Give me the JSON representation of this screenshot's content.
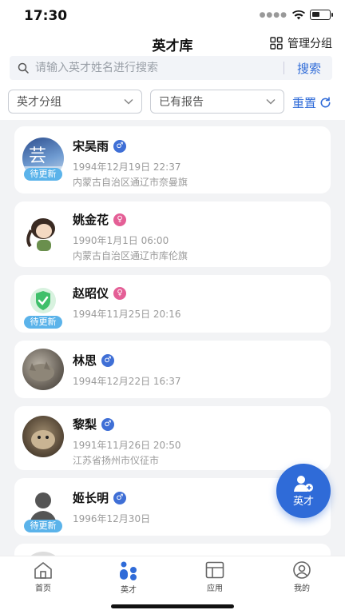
{
  "status": {
    "time": "17:30"
  },
  "header": {
    "title": "英才库",
    "manage_label": "管理分组"
  },
  "search": {
    "placeholder": "请输入英才姓名进行搜索",
    "value": "",
    "button": "搜索"
  },
  "filters": {
    "group_label": "英才分组",
    "report_label": "已有报告",
    "reset_label": "重置"
  },
  "badge_text": "待更新",
  "people": [
    {
      "name": "宋吴雨",
      "gender": "male",
      "gender_icon": "male-icon",
      "datetime": "1994年12月19日 22:37",
      "location": "内蒙古自治区通辽市奈曼旗",
      "badge": "待更新"
    },
    {
      "name": "姚金花",
      "gender": "female",
      "gender_icon": "female-icon",
      "datetime": "1990年1月1日 06:00",
      "location": "内蒙古自治区通辽市库伦旗",
      "badge": ""
    },
    {
      "name": "赵昭仪",
      "gender": "female",
      "gender_icon": "female-icon",
      "datetime": "1994年11月25日 20:16",
      "location": "",
      "badge": "待更新"
    },
    {
      "name": "林思",
      "gender": "male",
      "gender_icon": "male-icon",
      "datetime": "1994年12月22日 16:37",
      "location": "",
      "badge": ""
    },
    {
      "name": "黎梨",
      "gender": "male",
      "gender_icon": "male-icon",
      "datetime": "1991年11月26日 20:50",
      "location": "江苏省扬州市仪征市",
      "badge": ""
    },
    {
      "name": "姬长明",
      "gender": "male",
      "gender_icon": "male-icon",
      "datetime": "1996年12月30日",
      "location": "",
      "badge": "待更新"
    }
  ],
  "fab": {
    "label": "英才"
  },
  "tabs": [
    {
      "label": "首页",
      "icon": "home-icon",
      "active": false
    },
    {
      "label": "英才",
      "icon": "talent-icon",
      "active": true
    },
    {
      "label": "应用",
      "icon": "apps-icon",
      "active": false
    },
    {
      "label": "我的",
      "icon": "profile-icon",
      "active": false
    }
  ],
  "colors": {
    "accent": "#2f6bd8",
    "male": "#3f6fd6",
    "female": "#e45f96",
    "badge": "#5bb3ea"
  }
}
